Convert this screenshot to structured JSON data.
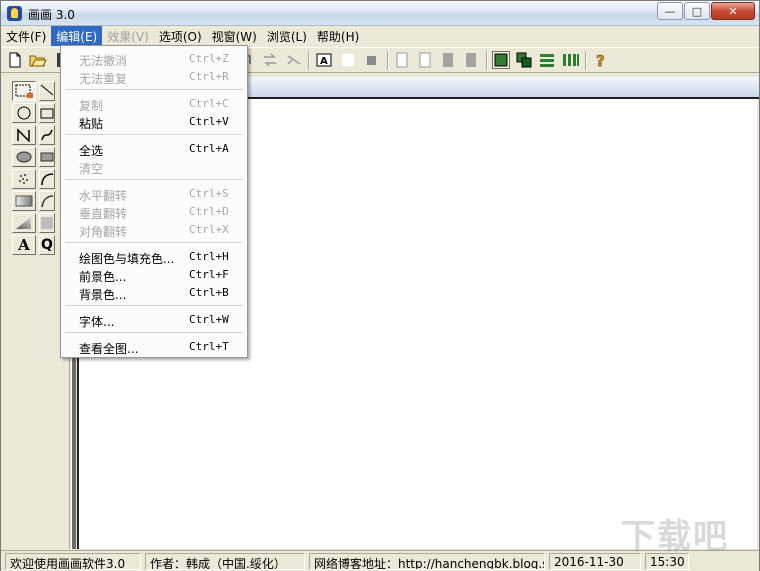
{
  "window": {
    "title": "画画 3.0",
    "min_label": "—",
    "max_label": "□",
    "close_label": "✕"
  },
  "menubar": {
    "items": [
      {
        "label": "文件(F)",
        "state": "normal"
      },
      {
        "label": "编辑(E)",
        "state": "active"
      },
      {
        "label": "效果(V)",
        "state": "disabled"
      },
      {
        "label": "选项(O)",
        "state": "normal"
      },
      {
        "label": "视窗(W)",
        "state": "normal"
      },
      {
        "label": "浏览(L)",
        "state": "normal"
      },
      {
        "label": "帮助(H)",
        "state": "normal"
      }
    ]
  },
  "edit_menu": {
    "items": [
      {
        "label": "无法撤消",
        "shortcut": "Ctrl+Z",
        "enabled": false
      },
      {
        "label": "无法重复",
        "shortcut": "Ctrl+R",
        "enabled": false
      },
      {
        "label": "复制",
        "shortcut": "Ctrl+C",
        "enabled": false
      },
      {
        "label": "粘贴",
        "shortcut": "Ctrl+V",
        "enabled": true
      },
      {
        "label": "全选",
        "shortcut": "Ctrl+A",
        "enabled": true
      },
      {
        "label": "清空",
        "shortcut": "",
        "enabled": false
      },
      {
        "label": "水平翻转",
        "shortcut": "Ctrl+S",
        "enabled": false
      },
      {
        "label": "垂直翻转",
        "shortcut": "Ctrl+D",
        "enabled": false
      },
      {
        "label": "对角翻转",
        "shortcut": "Ctrl+X",
        "enabled": false
      },
      {
        "label": "绘图色与填充色...",
        "shortcut": "Ctrl+H",
        "enabled": true
      },
      {
        "label": "前景色...",
        "shortcut": "Ctrl+F",
        "enabled": true
      },
      {
        "label": "背景色...",
        "shortcut": "Ctrl+B",
        "enabled": true
      },
      {
        "label": "字体...",
        "shortcut": "Ctrl+W",
        "enabled": true
      },
      {
        "label": "查看全图...",
        "shortcut": "Ctrl+T",
        "enabled": true
      }
    ]
  },
  "toolbar": {
    "icons": [
      "new-file-icon",
      "open-folder-icon",
      "save-icon",
      "rotate-icon",
      "swap-icon",
      "no-swap-icon",
      "text-frame-icon",
      "white-swatch-icon",
      "gray-swatch-icon",
      "outline-rect-icon",
      "outline-rect-2-icon",
      "gray-rect-icon",
      "gray-rect-2-icon",
      "green-square-icon",
      "overlap-squares-icon",
      "horizontal-lines-icon",
      "vertical-bars-icon",
      "help-icon"
    ]
  },
  "palette": {
    "tools": [
      "rect-select",
      "line",
      "ellipse",
      "rectangle",
      "polyline",
      "curve",
      "filled-ellipse",
      "filled-rect",
      "spray",
      "arc",
      "gradient-rect",
      "gradient-shape",
      "gradient-3d",
      "blur",
      "text",
      "magnifier"
    ],
    "text_glyph": "A",
    "magnifier_glyph": "Q"
  },
  "statusbar": {
    "welcome": "欢迎使用画画软件3.0",
    "author": "作者：韩成（中国.绥化）",
    "blog": "网络博客地址：http://hanchengbk.blog.sc",
    "date": "2016-11-30",
    "time": "15:30"
  },
  "watermark": "下载吧",
  "colors": {
    "menu_highlight": "#316ac5",
    "disabled_text": "#a7a7a7"
  }
}
